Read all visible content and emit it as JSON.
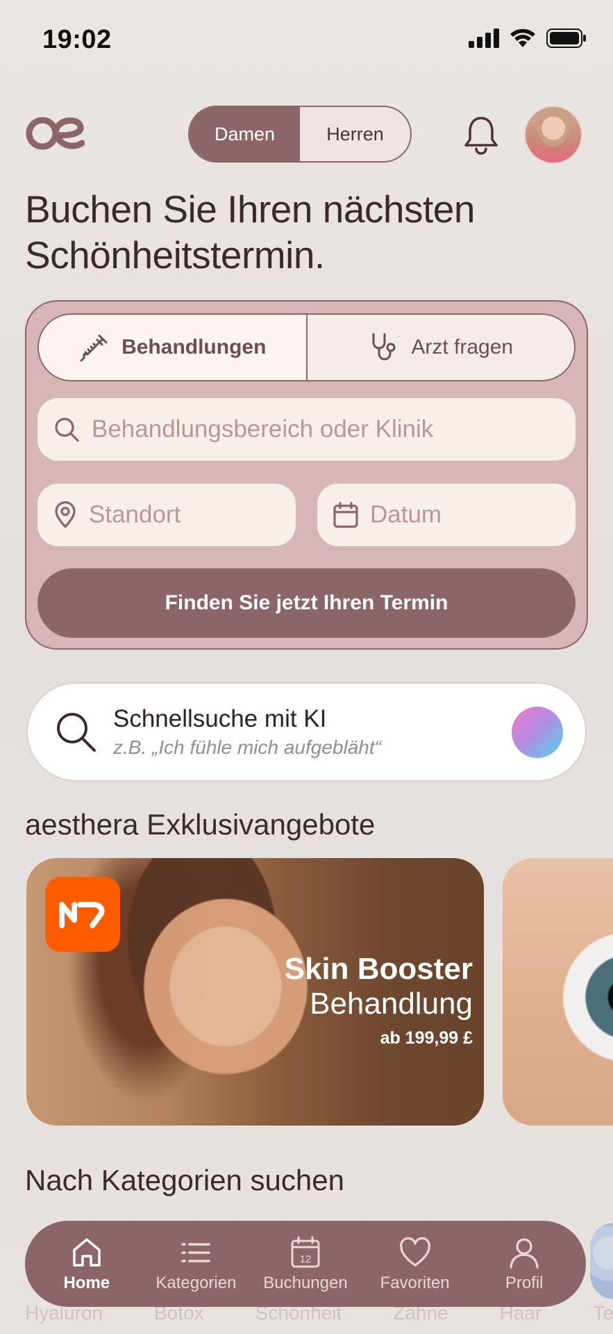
{
  "status_bar": {
    "time": "19:02"
  },
  "header": {
    "gender_toggle": {
      "options": [
        "Damen",
        "Herren"
      ],
      "selected": "Damen"
    }
  },
  "headline": "Buchen Sie Ihren nächsten Schönheitstermin.",
  "search_card": {
    "modes": [
      {
        "label": "Behandlungen",
        "icon": "syringe-icon",
        "active": true
      },
      {
        "label": "Arzt fragen",
        "icon": "stethoscope-icon",
        "active": false
      }
    ],
    "treatment_placeholder": "Behandlungsbereich oder Klinik",
    "location_placeholder": "Standort",
    "date_placeholder": "Datum",
    "submit_label": "Finden Sie jetzt Ihren Termin"
  },
  "ai_search": {
    "title": "Schnellsuche mit KI",
    "subtitle": "z.B. „Ich fühle mich aufgebläht“"
  },
  "offers": {
    "title": "aesthera Exklusivangebote",
    "items": [
      {
        "title": "Skin Booster",
        "subtitle": "Behandlung",
        "price": "ab 199,99 £"
      }
    ]
  },
  "categories": {
    "title": "Nach Kategorien suchen",
    "items": [
      "Hyaluron",
      "Botox",
      "Schönheit",
      "Zähne",
      "Haar",
      "Te"
    ]
  },
  "bottom_nav": {
    "items": [
      {
        "label": "Home",
        "icon": "home-icon",
        "active": true
      },
      {
        "label": "Kategorien",
        "icon": "list-icon",
        "active": false
      },
      {
        "label": "Buchungen",
        "icon": "calendar-icon",
        "active": false,
        "icon_text": "12"
      },
      {
        "label": "Favoriten",
        "icon": "heart-icon",
        "active": false
      },
      {
        "label": "Profil",
        "icon": "user-icon",
        "active": false
      }
    ]
  },
  "colors": {
    "accent": "#8b6567",
    "card": "#d7b6b8",
    "field": "#f6efea",
    "brand_badge": "#ff5c00"
  }
}
